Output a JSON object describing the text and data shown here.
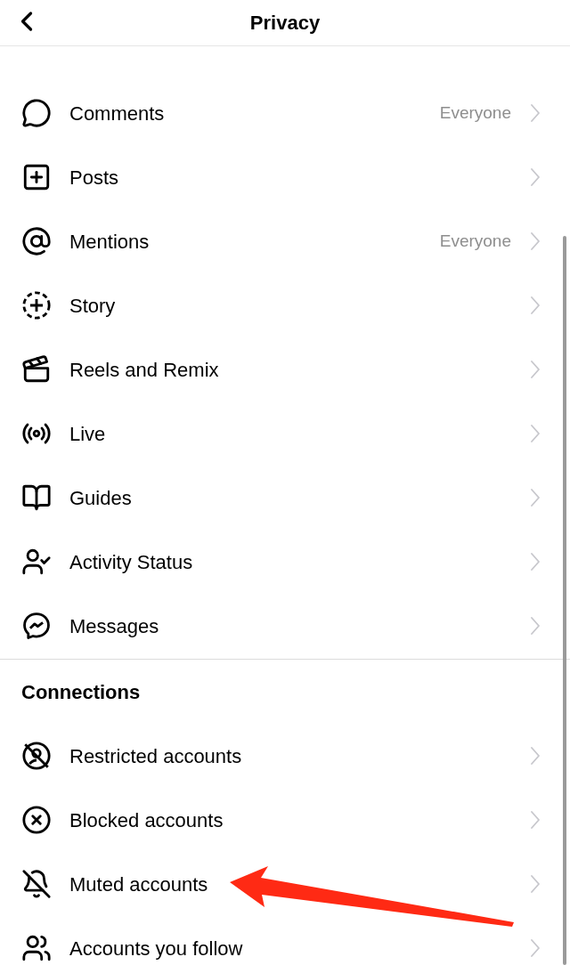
{
  "header": {
    "title": "Privacy"
  },
  "rows": [
    {
      "label": "Comments",
      "value": "Everyone"
    },
    {
      "label": "Posts"
    },
    {
      "label": "Mentions",
      "value": "Everyone"
    },
    {
      "label": "Story"
    },
    {
      "label": "Reels and Remix"
    },
    {
      "label": "Live"
    },
    {
      "label": "Guides"
    },
    {
      "label": "Activity Status"
    },
    {
      "label": "Messages"
    }
  ],
  "connections": {
    "heading": "Connections",
    "rows": [
      {
        "label": "Restricted accounts"
      },
      {
        "label": "Blocked accounts"
      },
      {
        "label": "Muted accounts"
      },
      {
        "label": "Accounts you follow"
      }
    ]
  }
}
